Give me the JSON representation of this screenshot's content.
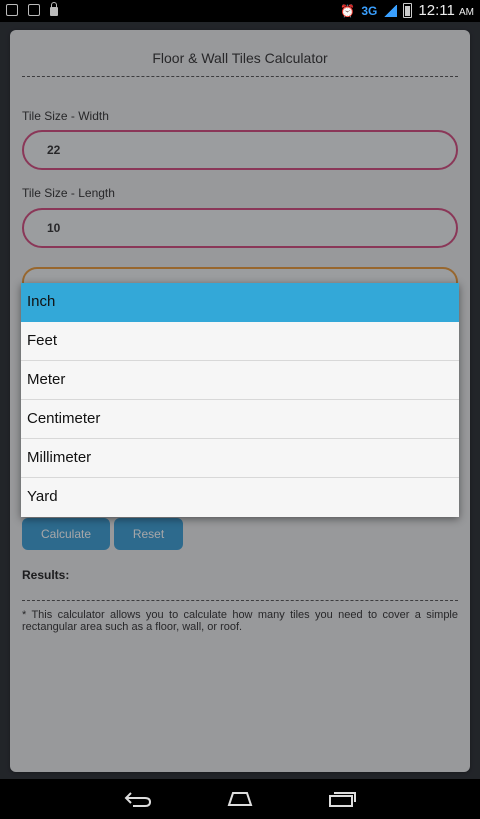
{
  "status_bar": {
    "network": "3G",
    "time": "12:11",
    "ampm": "AM"
  },
  "app": {
    "title": "Floor & Wall Tiles Calculator"
  },
  "fields": {
    "width_label": "Tile Size - Width",
    "width_value": "22",
    "length_label": "Tile Size - Length",
    "length_value": "10"
  },
  "buttons": {
    "calculate": "Calculate",
    "reset": "Reset"
  },
  "results_label": "Results:",
  "note": "* This calculator allows you to calculate how many tiles you need to cover a simple rectangular area such as a floor, wall, or roof.",
  "dropdown": {
    "options": [
      "Inch",
      "Feet",
      "Meter",
      "Centimeter",
      "Millimeter",
      "Yard"
    ],
    "selected": "Inch"
  },
  "colors": {
    "input_border": "#d24d7e",
    "select_border": "#e89a3a",
    "button": "#3d9fd4",
    "selected_option": "#33a8d8"
  }
}
